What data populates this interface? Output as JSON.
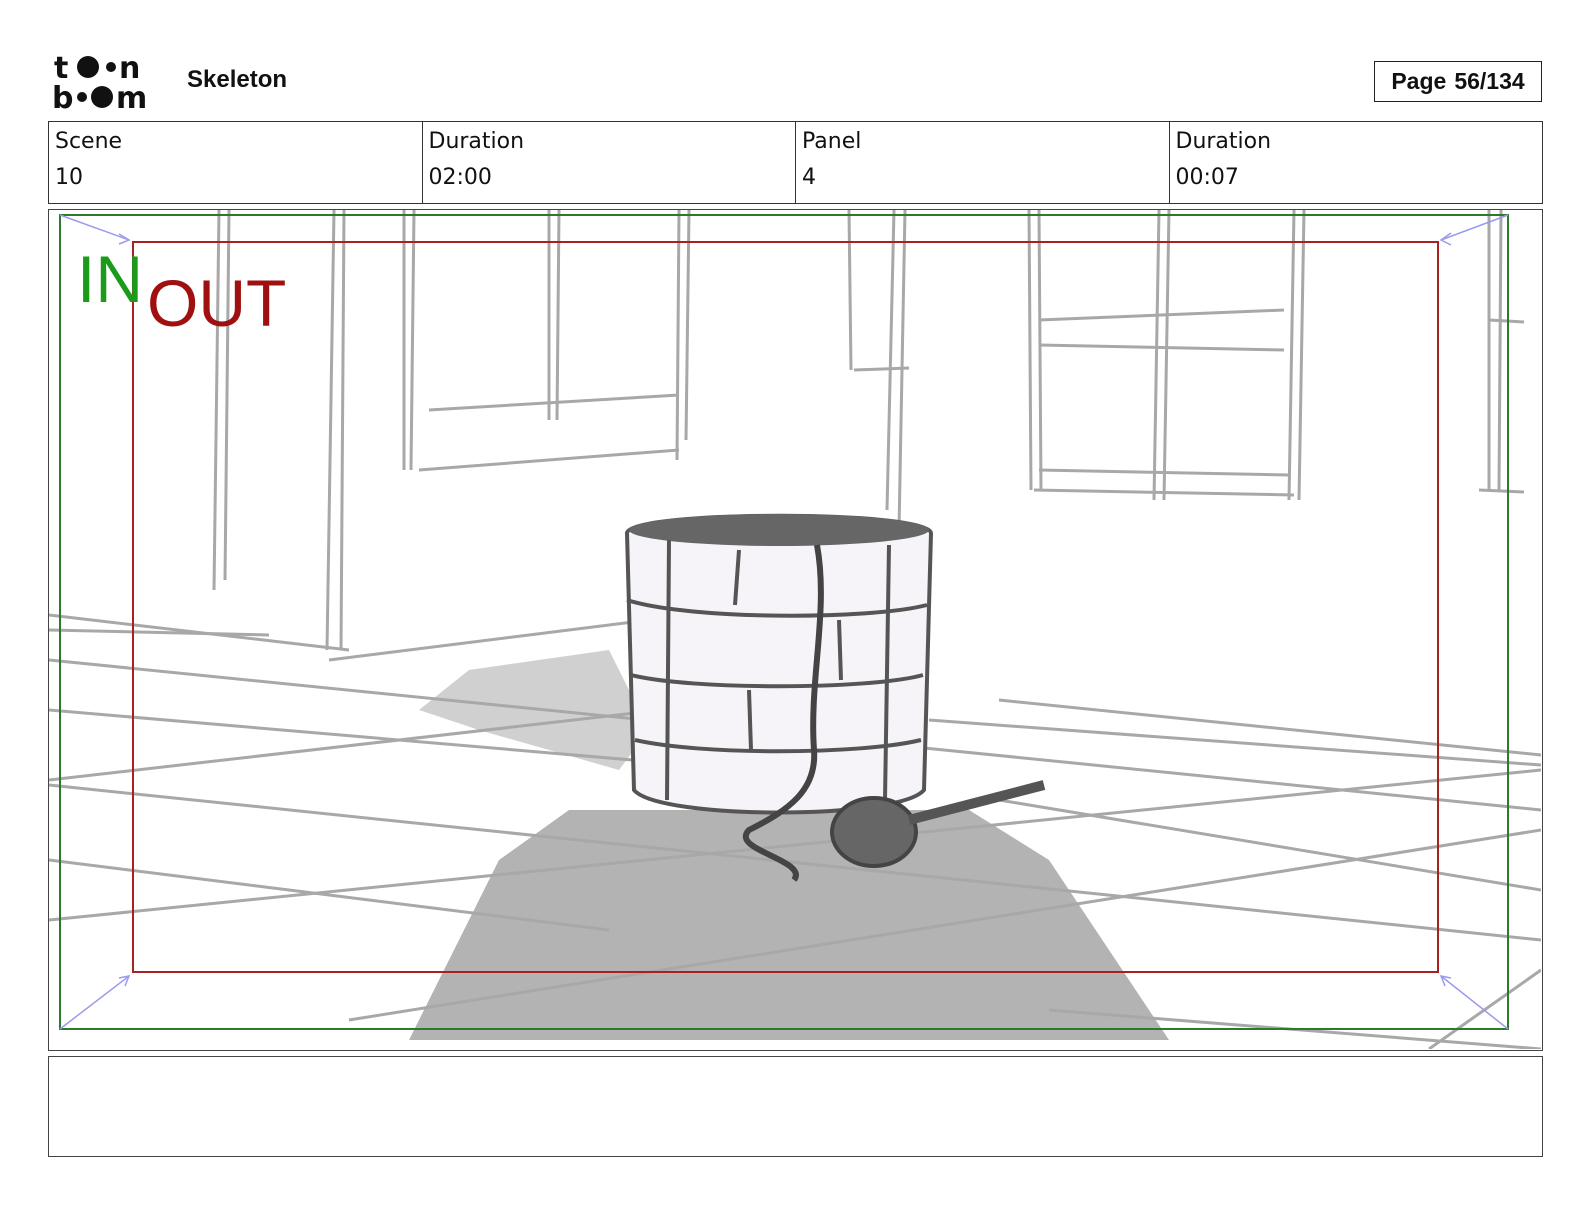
{
  "header": {
    "logo_text": "toon boom",
    "project_title": "Skeleton",
    "page_label": "Page",
    "page_number": "56/134"
  },
  "info": {
    "scene_label": "Scene",
    "scene_value": "10",
    "scene_duration_label": "Duration",
    "scene_duration_value": "02:00",
    "panel_label": "Panel",
    "panel_value": "4",
    "panel_duration_label": "Duration",
    "panel_duration_value": "00:07"
  },
  "panel_overlay": {
    "in_label": "IN",
    "out_label": "OUT",
    "in_color": "#1a9c1a",
    "out_color": "#a01010",
    "frame_green": "#2d7a2d",
    "frame_red": "#a82020",
    "corner_arrow_color": "#9a9af0"
  },
  "notes": {
    "text": ""
  }
}
